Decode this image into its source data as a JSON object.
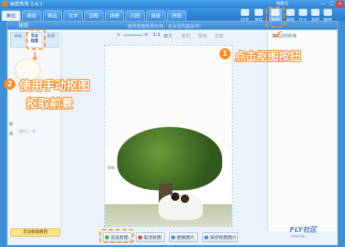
{
  "app": {
    "title": "美图秀秀 2.6.1",
    "user_label": "搜集见"
  },
  "tabs": [
    "美化",
    "美容",
    "饰品",
    "文字",
    "边框",
    "场景",
    "闪图",
    "娃娃",
    "拼图"
  ],
  "toolbar": [
    {
      "label": "打开",
      "icon": "folder-open-icon"
    },
    {
      "label": "保存",
      "icon": "save-icon"
    },
    {
      "label": "抠图",
      "icon": "cutout-icon"
    },
    {
      "label": "裁剪",
      "icon": "crop-icon"
    },
    {
      "label": "尺寸",
      "icon": "resize-icon"
    },
    {
      "label": "旋转",
      "icon": "rotate-icon"
    },
    {
      "label": "撤销",
      "icon": "undo-icon"
    }
  ],
  "dialog": {
    "title": "抠图",
    "notice": "觉得美图秀秀好用，告诉您的朋友吧!",
    "subtabs": [
      "自动",
      "手动\n抠图",
      "形状"
    ],
    "left_items": [
      "朱",
      "关"
    ],
    "left_thumb_caption": "返回上一步",
    "help_button": "手动抠图教程",
    "right_title": "使用过的前景",
    "zoom_label": "1:1",
    "zoom_option": "原大",
    "undo_label": "撤销",
    "redo_label": "重做",
    "reset_label": "还原",
    "photo_caption": "颐和",
    "buttons": [
      "完成抠图",
      "取消抠图",
      "更换图片",
      "保存抠图图片"
    ]
  },
  "annotations": {
    "step1_num": "1",
    "step1_text": "点击抠图按钮",
    "step2_num": "2",
    "step2_line1": "使用手动抠图",
    "step2_line2": "抠取前景"
  },
  "watermark": {
    "brand": "FLY社区",
    "sub": "www.fly..."
  },
  "colors": {
    "accent": "#ff8a1c",
    "tabbar": "#3c96e3"
  }
}
